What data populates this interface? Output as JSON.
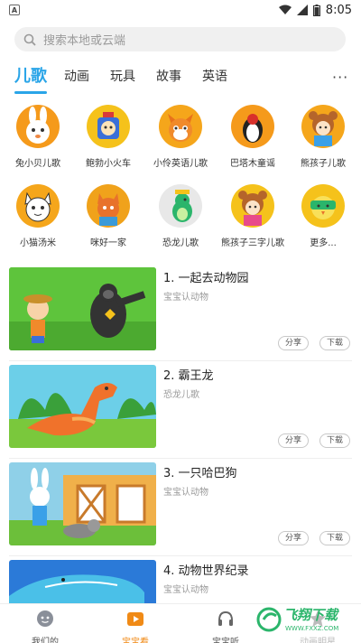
{
  "status": {
    "time": "8:05",
    "app_indicator": "A"
  },
  "search": {
    "placeholder": "搜索本地或云端"
  },
  "tabs": [
    {
      "label": "儿歌",
      "active": true
    },
    {
      "label": "动画"
    },
    {
      "label": "玩具"
    },
    {
      "label": "故事"
    },
    {
      "label": "英语"
    }
  ],
  "more_tabs": "···",
  "categories": [
    {
      "label": "兔小贝儿歌",
      "bg": "#f59a1b"
    },
    {
      "label": "鲍勃小火车",
      "bg": "#f5c21b"
    },
    {
      "label": "小伶英语儿歌",
      "bg": "#f5a61b"
    },
    {
      "label": "巴塔木童谣",
      "bg": "#f59a1b"
    },
    {
      "label": "熊孩子儿歌",
      "bg": "#f5a61b"
    },
    {
      "label": "小猫汤米",
      "bg": "#f5a61b"
    },
    {
      "label": "咪好一家",
      "bg": "#f0a21b"
    },
    {
      "label": "恐龙儿歌",
      "bg": "#e8e8e8"
    },
    {
      "label": "熊孩子三字儿歌",
      "bg": "#f5c21b"
    },
    {
      "label": "更多...",
      "bg": "#f5c21b"
    }
  ],
  "items": [
    {
      "title": "1. 一起去动物园",
      "sub": "宝宝认动物",
      "share": "分享",
      "download": "下载"
    },
    {
      "title": "2. 霸王龙",
      "sub": "恐龙儿歌",
      "share": "分享",
      "download": "下载"
    },
    {
      "title": "3. 一只哈巴狗",
      "sub": "宝宝认动物",
      "share": "分享",
      "download": "下载"
    },
    {
      "title": "4. 动物世界纪录",
      "sub": "宝宝认动物"
    }
  ],
  "nav": [
    {
      "label": "我们的",
      "icon": "face-icon"
    },
    {
      "label": "宝宝看",
      "icon": "tv-icon",
      "active": true
    },
    {
      "label": "宝宝听",
      "icon": "headphone-icon"
    },
    {
      "label": "动画明星",
      "icon": "star-icon"
    }
  ],
  "watermark": {
    "text": "飞翔下载",
    "sub": "WWW.FXXZ.COM"
  },
  "colors": {
    "accent": "#2aa5e8",
    "nav_active": "#f08a16"
  }
}
